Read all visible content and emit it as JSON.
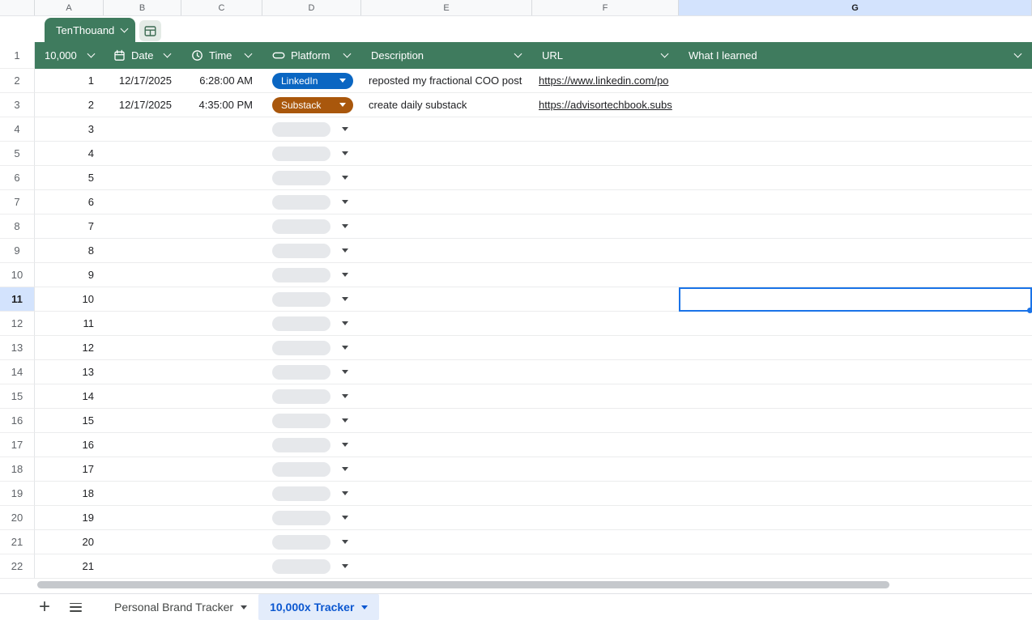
{
  "sheet": {
    "column_letters": [
      "A",
      "B",
      "C",
      "D",
      "E",
      "F",
      "G"
    ],
    "selected_column": "G",
    "selected_row_number": 11,
    "row_count": 22
  },
  "table": {
    "name": "TenThouand",
    "header_bg": "#3f7b5e",
    "headers": {
      "count": "10,000",
      "date": "Date",
      "time": "Time",
      "platform": "Platform",
      "description": "Description",
      "url": "URL",
      "learned": "What I learned"
    }
  },
  "platform_colors": {
    "LinkedIn": "#0a66c2",
    "Substack": "#a9570c"
  },
  "rows": [
    {
      "n": 1,
      "date": "12/17/2025",
      "time": "6:28:00 AM",
      "platform": "LinkedIn",
      "description": "reposted my fractional COO post",
      "url": "https://www.linkedin.com/po"
    },
    {
      "n": 2,
      "date": "12/17/2025",
      "time": "4:35:00 PM",
      "platform": "Substack",
      "description": "create daily substack",
      "url": "https://advisortechbook.subs"
    },
    {
      "n": 3
    },
    {
      "n": 4
    },
    {
      "n": 5
    },
    {
      "n": 6
    },
    {
      "n": 7
    },
    {
      "n": 8
    },
    {
      "n": 9
    },
    {
      "n": 10
    },
    {
      "n": 11
    },
    {
      "n": 12
    },
    {
      "n": 13
    },
    {
      "n": 14
    },
    {
      "n": 15
    },
    {
      "n": 16
    },
    {
      "n": 17
    },
    {
      "n": 18
    },
    {
      "n": 19
    },
    {
      "n": 20
    },
    {
      "n": 21
    }
  ],
  "selection": {
    "cell_border": "#1a73e8",
    "header_highlight": "#d3e3fd"
  },
  "footer": {
    "add_label": "+",
    "sheet_tabs": [
      {
        "label": "Personal Brand Tracker",
        "active": false
      },
      {
        "label": "10,000x Tracker",
        "active": true
      }
    ],
    "active_tab_bg": "#e3ecfb",
    "active_tab_text": "#0b57d0"
  }
}
